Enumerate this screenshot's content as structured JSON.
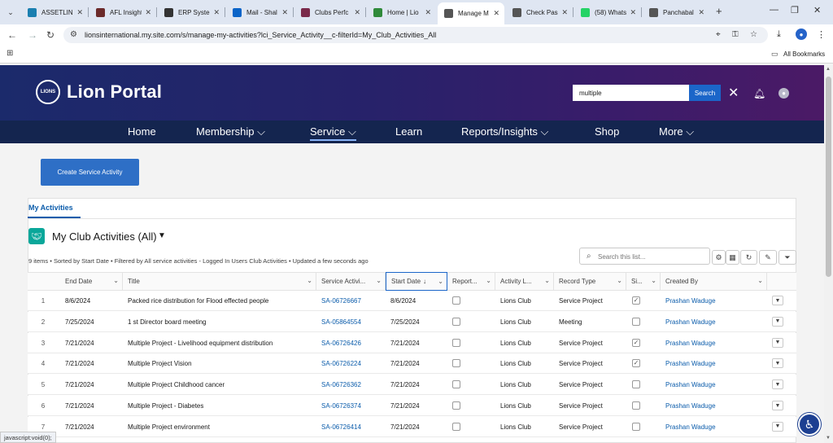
{
  "browser": {
    "tabs": [
      {
        "title": "ASSETLINE",
        "favicon_color": "#1a7fb0"
      },
      {
        "title": "AFL Insight",
        "favicon_color": "#6b2a2a"
      },
      {
        "title": "ERP System",
        "favicon_color": "#333333"
      },
      {
        "title": "Mail - Shal",
        "favicon_color": "#0a64c8"
      },
      {
        "title": "Clubs Perfc",
        "favicon_color": "#7a2a4a"
      },
      {
        "title": "Home | Lio",
        "favicon_color": "#2f8a3a"
      },
      {
        "title": "Manage M",
        "favicon_color": "#555555"
      },
      {
        "title": "Check Pass",
        "favicon_color": "#555555"
      },
      {
        "title": "(58) Whats",
        "favicon_color": "#25d366"
      },
      {
        "title": "Panchabal",
        "favicon_color": "#555555"
      }
    ],
    "active_tab_index": 6,
    "url": "lionsinternational.my.site.com/s/manage-my-activities?lci_Service_Activity__c-filterId=My_Club_Activities_All",
    "bookmarks_label": "All Bookmarks"
  },
  "portal": {
    "title": "Lion Portal",
    "logo_text": "LIONS",
    "search_value": "multiple",
    "search_button": "Search",
    "nav": [
      {
        "label": "Home",
        "has_menu": false
      },
      {
        "label": "Membership ⌵",
        "has_menu": true
      },
      {
        "label": "Service ⌵",
        "has_menu": true
      },
      {
        "label": "Learn",
        "has_menu": false
      },
      {
        "label": "Reports/Insights ⌵",
        "has_menu": true
      },
      {
        "label": "Shop",
        "has_menu": false
      },
      {
        "label": "More ⌵",
        "has_menu": true
      }
    ],
    "active_nav": "Service"
  },
  "page": {
    "create_button": "Create Service Activity",
    "tab_label": "My Activities",
    "list_title": "My Club Activities (All)",
    "list_meta": "9 items • Sorted by Start Date • Filtered by All service activities - Logged In Users Club Activities • Updated a few seconds ago",
    "search_placeholder": "Search this list..."
  },
  "table": {
    "columns": [
      "End Date",
      "Title",
      "Service Activi...",
      "Start Date",
      "Report...",
      "Activity L...",
      "Record Type",
      "Si...",
      "Created By"
    ],
    "sort_arrow": "↓",
    "rows": [
      {
        "num": "1",
        "end": "8/6/2024",
        "title": "Packed rice distribution for Flood effected people",
        "id": "SA-06726667",
        "start": "8/6/2024",
        "reported": false,
        "level": "Lions Club",
        "type": "Service Project",
        "signature": true,
        "by": "Prashan Waduge"
      },
      {
        "num": "2",
        "end": "7/25/2024",
        "title": "1 st Director board meeting",
        "id": "SA-05864554",
        "start": "7/25/2024",
        "reported": false,
        "level": "Lions Club",
        "type": "Meeting",
        "signature": false,
        "by": "Prashan Waduge"
      },
      {
        "num": "3",
        "end": "7/21/2024",
        "title": "Multiple Project - Livelihood equipment distribution",
        "id": "SA-06726426",
        "start": "7/21/2024",
        "reported": false,
        "level": "Lions Club",
        "type": "Service Project",
        "signature": true,
        "by": "Prashan Waduge"
      },
      {
        "num": "4",
        "end": "7/21/2024",
        "title": "Multiple Project Vision",
        "id": "SA-06726224",
        "start": "7/21/2024",
        "reported": false,
        "level": "Lions Club",
        "type": "Service Project",
        "signature": true,
        "by": "Prashan Waduge"
      },
      {
        "num": "5",
        "end": "7/21/2024",
        "title": "Multiple Project Childhood cancer",
        "id": "SA-06726362",
        "start": "7/21/2024",
        "reported": false,
        "level": "Lions Club",
        "type": "Service Project",
        "signature": false,
        "by": "Prashan Waduge"
      },
      {
        "num": "6",
        "end": "7/21/2024",
        "title": "Multiple Project - Diabetes",
        "id": "SA-06726374",
        "start": "7/21/2024",
        "reported": false,
        "level": "Lions Club",
        "type": "Service Project",
        "signature": false,
        "by": "Prashan Waduge"
      },
      {
        "num": "7",
        "end": "7/21/2024",
        "title": "Multiple Project environment",
        "id": "SA-06726414",
        "start": "7/21/2024",
        "reported": false,
        "level": "Lions Club",
        "type": "Service Project",
        "signature": false,
        "by": "Prashan Waduge"
      }
    ]
  },
  "status_bar": "javascript:void(0);",
  "icons": {
    "search": "search-icon",
    "bell": "bell-icon",
    "user": "user-avatar-icon",
    "close": "close-icon",
    "accessibility": "accessibility-icon"
  }
}
